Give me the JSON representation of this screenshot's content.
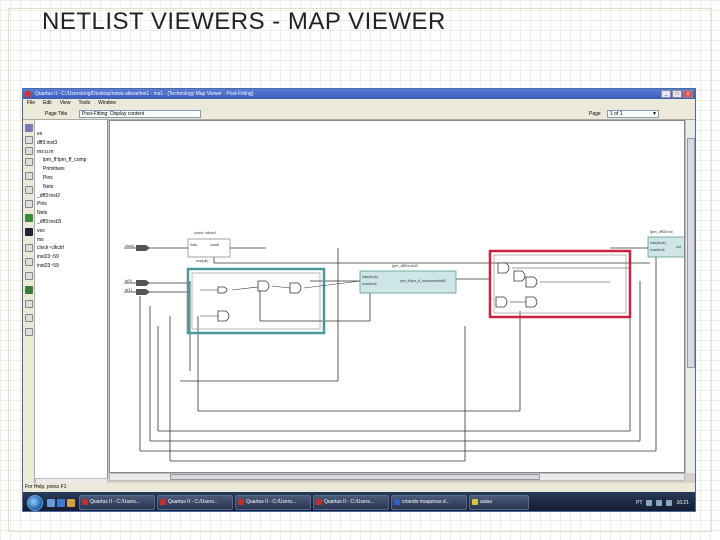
{
  "slide": {
    "title": "NETLIST VIEWERS - MAP VIEWER"
  },
  "window": {
    "title": "Quartus II - C:/Users/erig/Desktop/nowa atlese/ms1 - ms1 - [Technology Map Viewer - Post-Fitting]",
    "controls": {
      "minimize": "_",
      "maximize": "□",
      "close": "x"
    }
  },
  "menu": [
    "File",
    "Edit",
    "View",
    "Tools",
    "Window"
  ],
  "toolbar": {
    "page_title_label": "Page Title",
    "page_title_value": "Post-Fitting: Display content",
    "page_label": "Page",
    "page_value": "1 of 1"
  },
  "nav_tree": [
    "es",
    "dff3:inst3",
    "ms:u.m",
    "lpm_ff:lpm_ff_comp",
    "Primitives",
    "Pins",
    "Nets",
    "_dff3:inst2",
    "Pins",
    "Nets",
    "_dff3:inst2l",
    "ves",
    "ms",
    "clock~clkctrl",
    "inst23~59",
    "inst23~59"
  ],
  "canvas": {
    "labels": {
      "clock_block": "clock~clkctrl",
      "clock_inclk": "inclk",
      "clock_outclk": "outclk",
      "clock_sub": "ena(clk)",
      "middle_block": "lpm_dff3:inst2l",
      "middle_in1": "inst(clock)",
      "middle_in2": "ena/clock",
      "middle_inner": "lpm_ff:lpm_ff_component/dff1",
      "right_block": "lpm_dff3:inst",
      "right_in1": "inst(clock)",
      "right_in2": "ena/clock",
      "right_out": "out",
      "pin_clock": "clock",
      "pin_a": "d(0)",
      "pin_b": "d(1)"
    },
    "highlight_colors": {
      "teal": "#4a9a9a",
      "red": "#d02040"
    }
  },
  "status_bar": {
    "text": "For Help, press F1"
  },
  "taskbar": {
    "tasks": [
      {
        "label": "Quartus II - C:/Users...",
        "color": "#c03030"
      },
      {
        "label": "Quartus II - C:/Users...",
        "color": "#c03030"
      },
      {
        "label": "Quartus II - C:/Users...",
        "color": "#c03030"
      },
      {
        "label": "Quartus II - C:/Users...",
        "color": "#c03030"
      },
      {
        "label": "criando maquinas d...",
        "color": "#3060c0"
      },
      {
        "label": "aulas",
        "color": "#e0c040"
      }
    ],
    "tray": {
      "lang": "PT",
      "clock": "16:21"
    }
  }
}
